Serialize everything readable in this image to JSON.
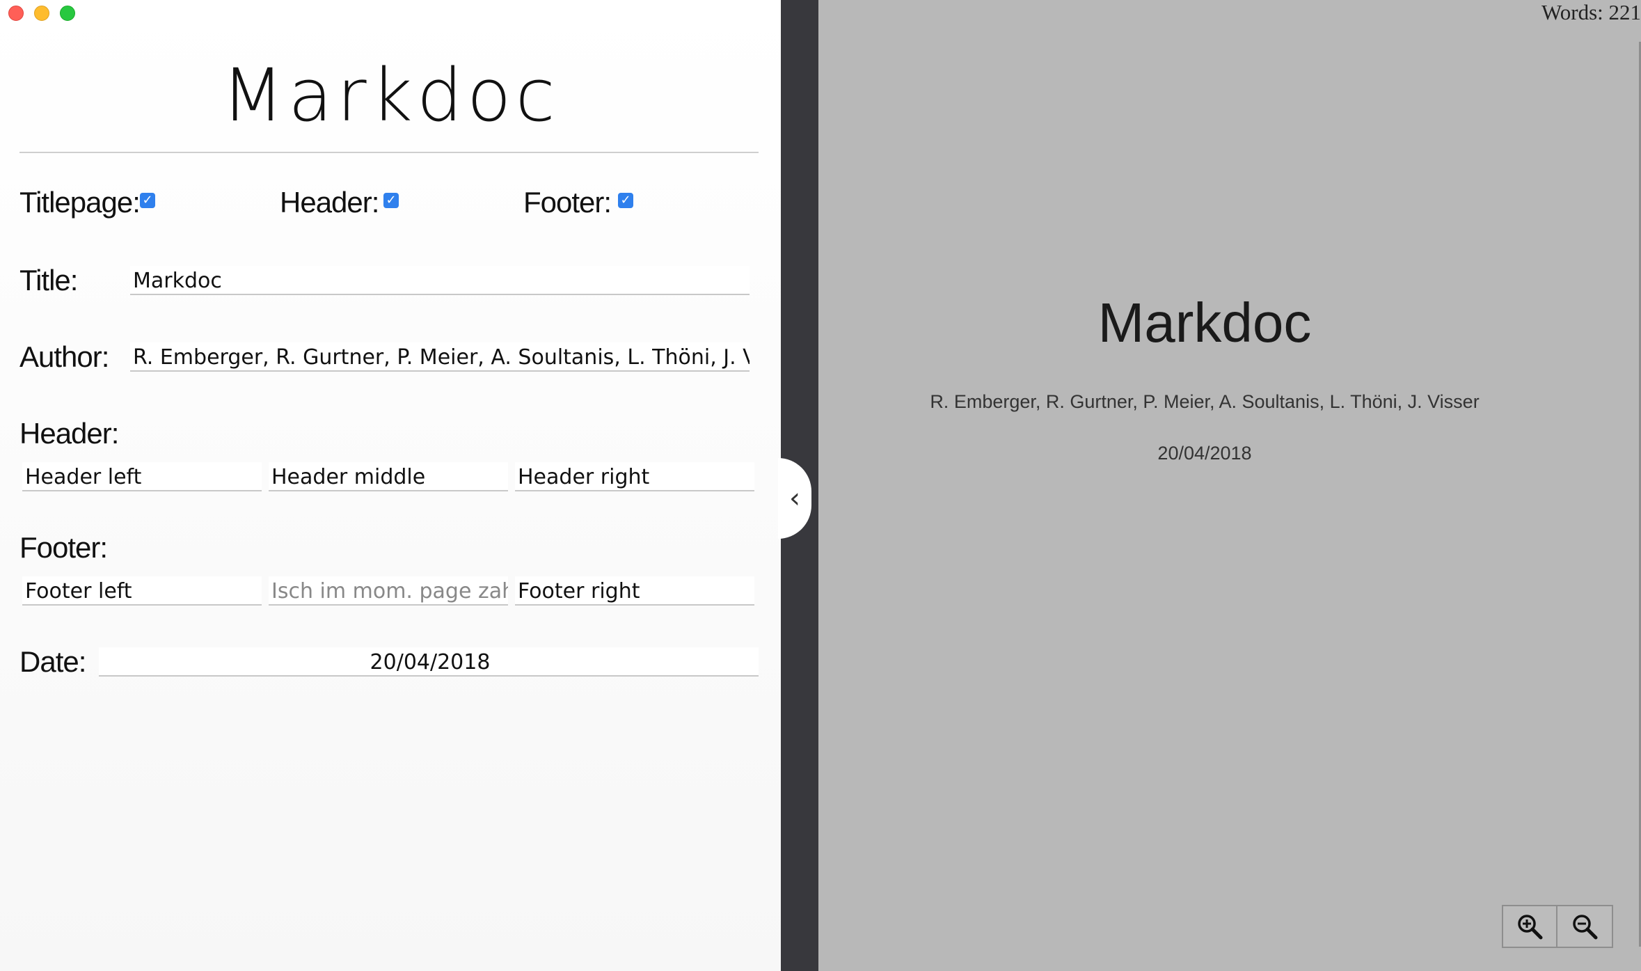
{
  "app": {
    "title": "Markdoc"
  },
  "options": {
    "titlepage_label": "Titlepage:",
    "header_label": "Header:",
    "footer_label": "Footer:",
    "check_mark": "✓"
  },
  "form": {
    "title_label": "Title:",
    "title_value": "Markdoc",
    "author_label": "Author:",
    "author_value": "R. Emberger, R. Gurtner, P. Meier, A. Soultanis, L. Thöni, J. Visser",
    "header_section_label": "Header:",
    "header_left": "Header left",
    "header_middle": "Header middle",
    "header_right": "Header right",
    "footer_section_label": "Footer:",
    "footer_left": "Footer left",
    "footer_middle_placeholder": "Isch im mom. page zahl",
    "footer_right": "Footer right",
    "date_label": "Date:",
    "date_value": "20/04/2018"
  },
  "divider": {
    "toggle_icon": "‹"
  },
  "preview": {
    "word_count": "Words: 221",
    "title": "Markdoc",
    "author": "R. Emberger, R. Gurtner, P. Meier, A. Soultanis, L. Thöni, J. Visser",
    "date": "20/04/2018"
  },
  "icons": {
    "close": "close-window-icon",
    "minimize": "minimize-window-icon",
    "maximize": "maximize-window-icon",
    "zoom_in": "zoom-in-icon",
    "zoom_out": "zoom-out-icon"
  },
  "colors": {
    "checkbox": "#2f80ed",
    "preview_bg": "#b8b8b8",
    "divider": "#38383d"
  }
}
